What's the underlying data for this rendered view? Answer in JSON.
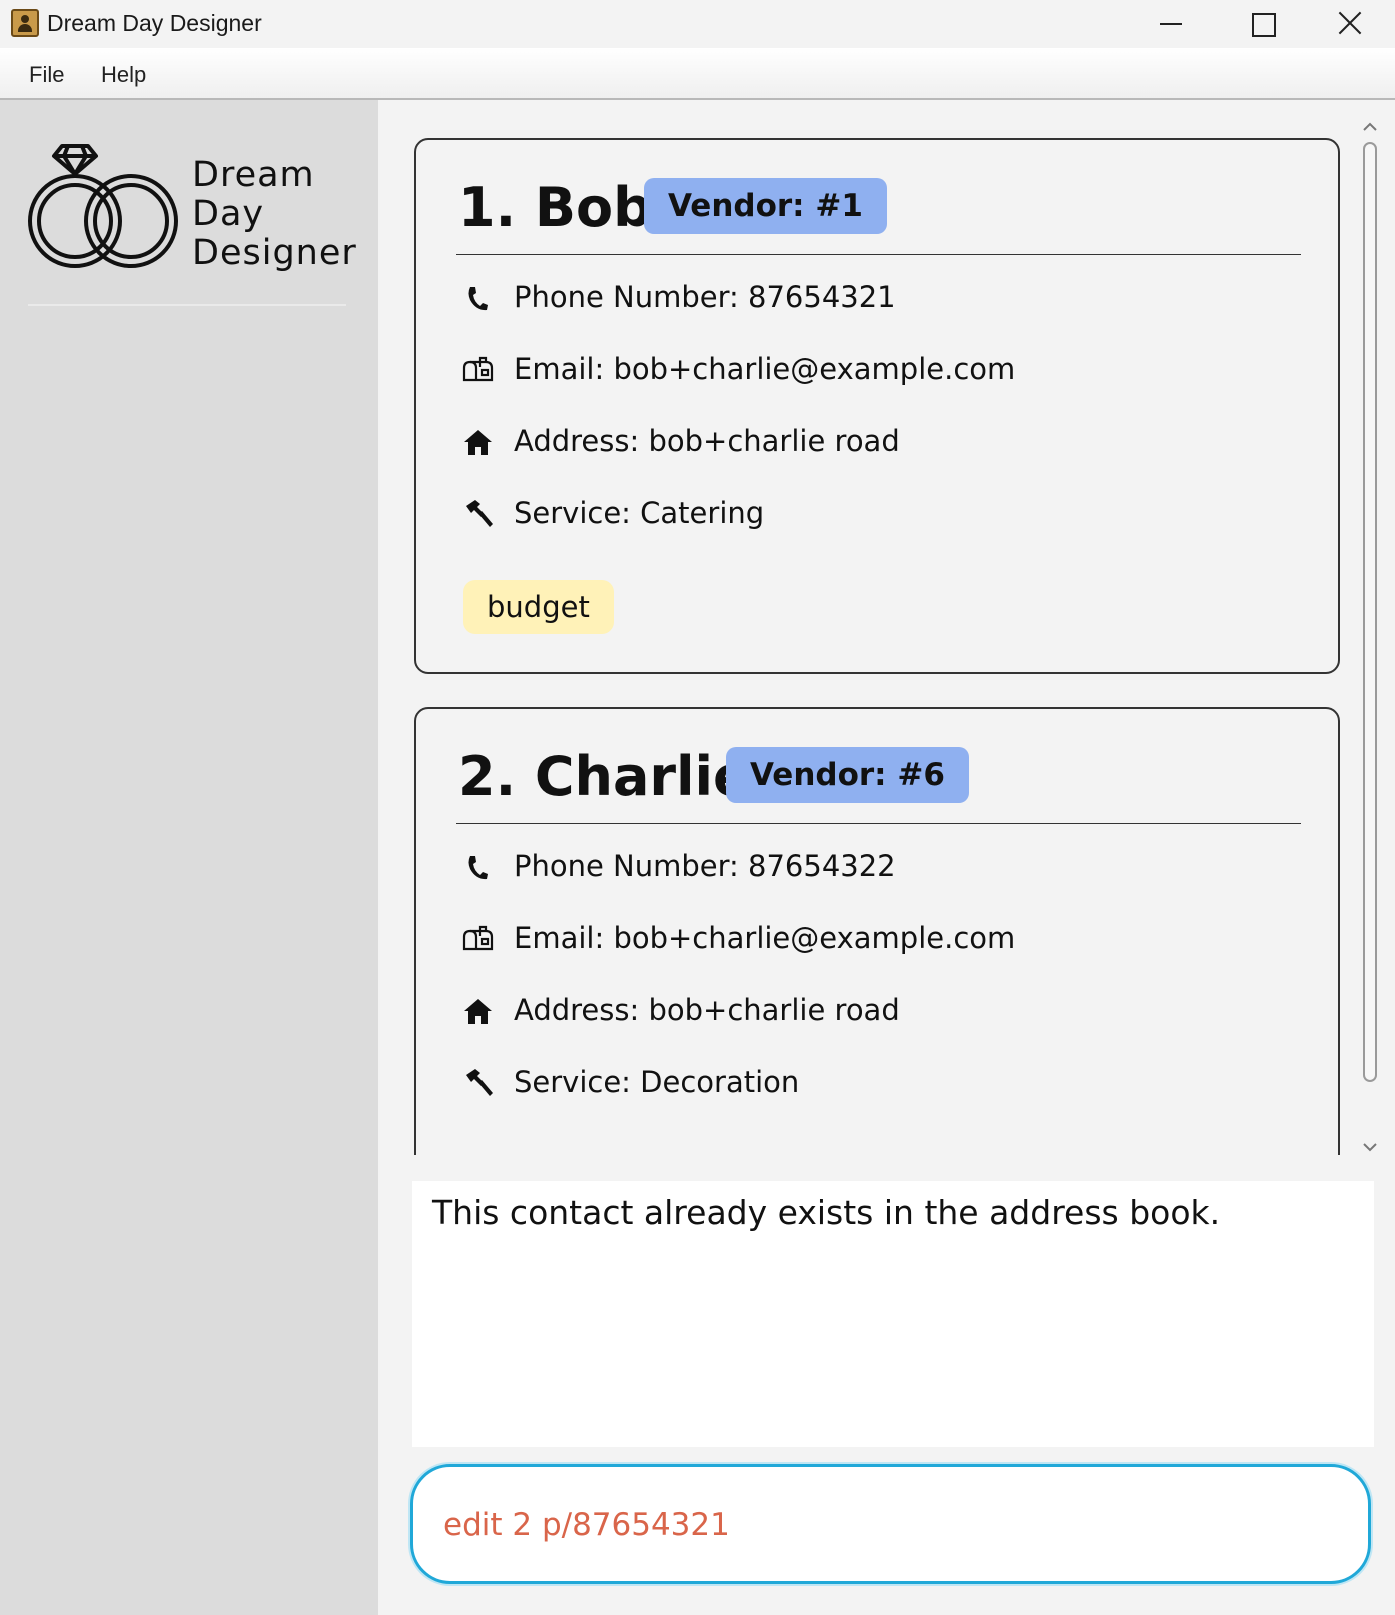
{
  "window": {
    "title": "Dream Day Designer"
  },
  "menu": {
    "file": "File",
    "help": "Help"
  },
  "logo": {
    "text": "Dream\nDay\nDesigner"
  },
  "contacts": [
    {
      "name": "1. Bob",
      "vendor_badge": "Vendor: #1",
      "phone": "Phone Number: 87654321",
      "email": "Email: bob+charlie@example.com",
      "address": "Address: bob+charlie road",
      "service": "Service: Catering",
      "tags": [
        "budget"
      ]
    },
    {
      "name": "2. Charlie",
      "vendor_badge": "Vendor: #6",
      "phone": "Phone Number: 87654322",
      "email": "Email: bob+charlie@example.com",
      "address": "Address: bob+charlie road",
      "service": "Service: Decoration",
      "tags": []
    }
  ],
  "icons": {
    "phone": "phone-icon",
    "email": "mailbox-icon",
    "address": "home-icon",
    "service": "hammer-icon"
  },
  "result": {
    "message": "This contact already exists in the address book."
  },
  "command": {
    "value": "edit 2 p/87654321"
  },
  "colors": {
    "vendor_badge": "#8fb0f0",
    "tag": "#fff2b8",
    "command_text": "#d9654a",
    "command_border": "#20a8d8",
    "sidebar": "#dcdcdc"
  }
}
